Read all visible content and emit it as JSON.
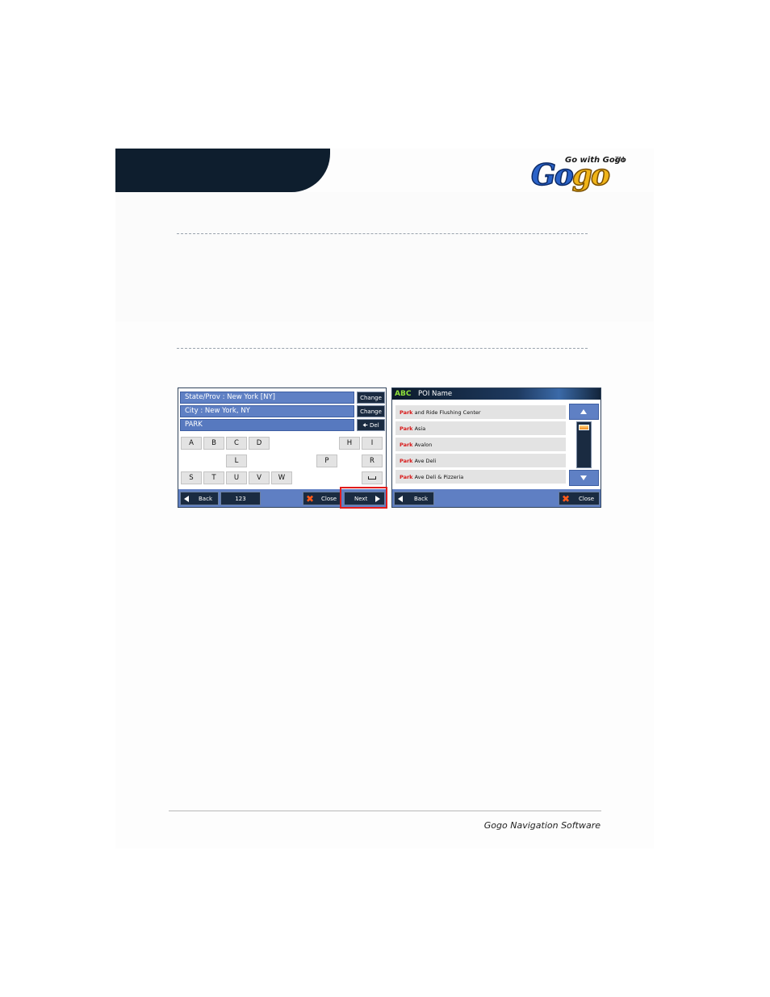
{
  "logo": {
    "tagline": "Go with Gogo",
    "trademark": "TM",
    "word_part1": "Go",
    "word_part2": "go"
  },
  "keyboard_screen": {
    "fields": {
      "state": "State/Prov : New York [NY]",
      "city": "City : New York, NY",
      "input": "PARK"
    },
    "side_buttons": {
      "change_state": "Change",
      "change_city": "Change",
      "delete": "Del"
    },
    "keys": [
      "A",
      "B",
      "C",
      "D",
      "H",
      "I",
      "L",
      "P",
      "R",
      "S",
      "T",
      "U",
      "V",
      "W"
    ],
    "bottom": {
      "back": "Back",
      "numeric": "123",
      "close": "Close",
      "next": "Next"
    }
  },
  "list_screen": {
    "header_icon": "ABC",
    "title": "POI Name",
    "items": [
      {
        "match": "Park",
        "rest": " and Ride Flushing Center"
      },
      {
        "match": "Park",
        "rest": " Asia"
      },
      {
        "match": "Park",
        "rest": " Avalon"
      },
      {
        "match": "Park",
        "rest": " Ave Deli"
      },
      {
        "match": "Park",
        "rest": " Ave Deli & Pizzeria"
      }
    ],
    "bottom": {
      "back": "Back",
      "close": "Close"
    }
  },
  "footer": {
    "text": "Gogo Navigation Software"
  },
  "colors": {
    "header_tab": "#0e1e2e",
    "field_blue": "#5f80c4",
    "dark_button": "#1a2b41",
    "highlight_red": "#e11c1c",
    "match_red": "#d81818"
  }
}
